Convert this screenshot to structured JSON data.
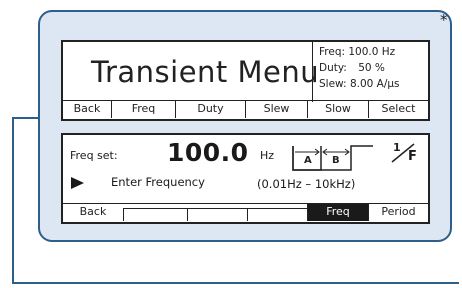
{
  "callout": {
    "marker": "*"
  },
  "menu_screen": {
    "title": "Transient Menu",
    "info": [
      {
        "label": "Freq:",
        "value": "100.0 Hz"
      },
      {
        "label": "Duty:",
        "value": "50 %"
      },
      {
        "label": "Slew:",
        "value": "8.00 A/µs"
      }
    ],
    "softkeys": [
      "Back",
      "Freq",
      "Duty",
      "Slew",
      "Slow",
      "Select"
    ]
  },
  "freq_screen": {
    "label": "Freq set:",
    "value": "100.0",
    "unit": "Hz",
    "prompt": "Enter Frequency",
    "range": "(0.01Hz – 10kHz)",
    "wave_labels": {
      "a": "A",
      "b": "B"
    },
    "inverse_label": "F",
    "softkeys": [
      "Back",
      "",
      "",
      "",
      "Freq",
      "Period"
    ],
    "selected_softkey": "Freq"
  },
  "colors": {
    "panel_fill": "#dce7f3",
    "panel_border": "#2e5f8a",
    "screen_fill": "#ffffff",
    "highlight": "#1a1a1a"
  }
}
